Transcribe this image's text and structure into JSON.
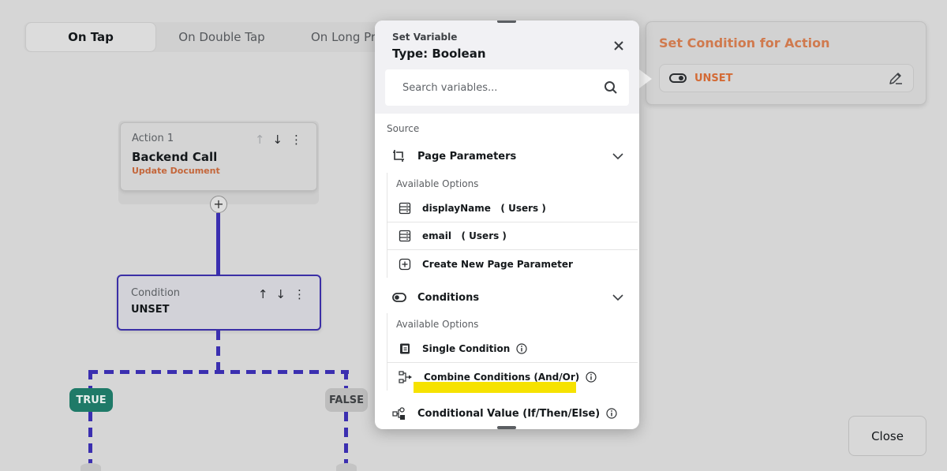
{
  "tabs": [
    {
      "label": "On Tap"
    },
    {
      "label": "On Double Tap"
    },
    {
      "label": "On Long Press"
    }
  ],
  "action_card": {
    "index_label": "Action 1",
    "title": "Backend Call",
    "subtitle": "Update Document"
  },
  "condition_card": {
    "label": "Condition",
    "value": "UNSET"
  },
  "branches": {
    "true_label": "TRUE",
    "false_label": "FALSE"
  },
  "condition_panel": {
    "title": "Set Condition for Action",
    "value": "UNSET"
  },
  "popup": {
    "label": "Set Variable",
    "type_label": "Type: Boolean",
    "search_placeholder": "Search variables...",
    "source_label": "Source",
    "sections": [
      {
        "name": "Page Parameters",
        "options_header": "Available Options",
        "options": [
          {
            "label": "displayName   ( Users )"
          },
          {
            "label": "email   ( Users )"
          },
          {
            "label": "Create New Page Parameter"
          }
        ]
      },
      {
        "name": "Conditions",
        "options_header": "Available Options",
        "options": [
          {
            "label": "Single Condition"
          },
          {
            "label": "Combine Conditions (And/Or)"
          }
        ]
      }
    ],
    "conditional_value_label": "Conditional Value (If/Then/Else)"
  },
  "close_button_label": "Close",
  "colors": {
    "accent_purple": "#3b2fb0",
    "true_green": "#1f7a68",
    "unset_orange": "#d36a35",
    "highlight_yellow": "#f6e200"
  }
}
